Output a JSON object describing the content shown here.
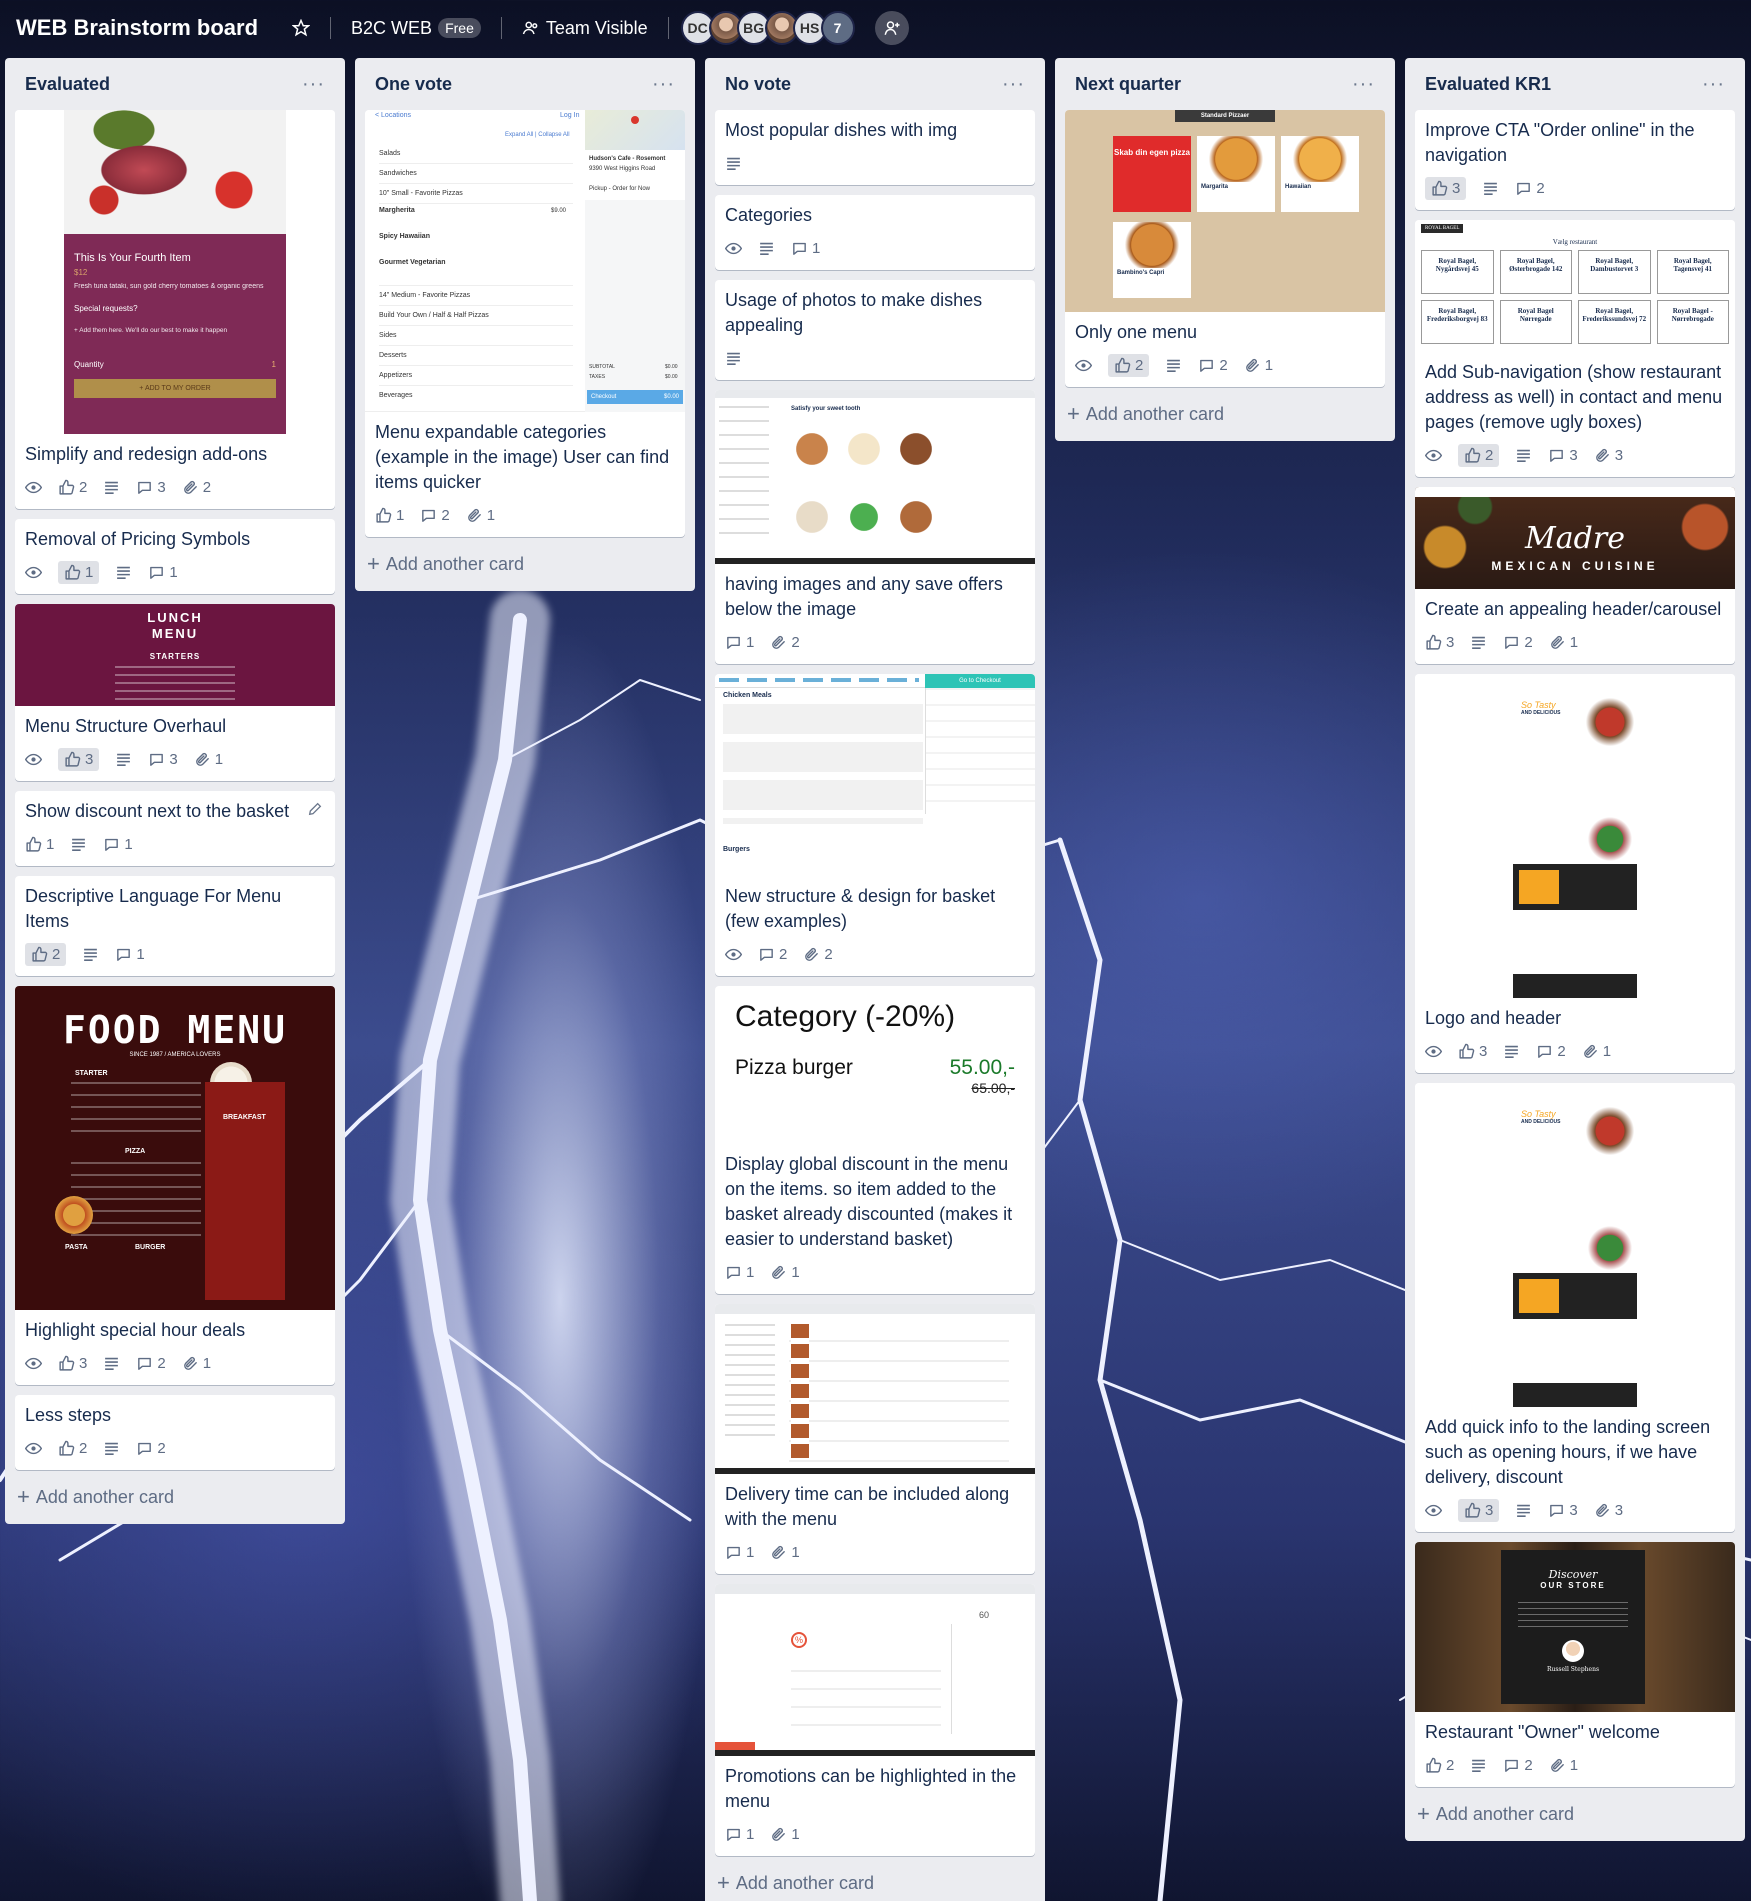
{
  "header": {
    "board_title": "WEB Brainstorm board",
    "team": "B2C WEB",
    "plan_badge": "Free",
    "visibility": "Team Visible",
    "members": [
      {
        "initials": "DC"
      },
      {
        "initials": ""
      },
      {
        "initials": "BG"
      },
      {
        "initials": ""
      },
      {
        "initials": "HS"
      }
    ],
    "extra_count": "7"
  },
  "add_card_label": "Add another card",
  "lists": [
    {
      "title": "Evaluated",
      "cards": [
        {
          "title": "Simplify and redesign add-ons",
          "votes": "2",
          "comments": "3",
          "attachments": "2",
          "cover": {
            "item": "This Is Your Fourth Item",
            "price": "$12",
            "desc": "Fresh tuna tataki, sun gold cherry tomatoes & organic greens",
            "special": "Special requests?",
            "add_hint": "+ Add them here. We'll do our best to make it happen",
            "quantity_label": "Quantity",
            "qty": "1",
            "cta": "+ ADD TO MY ORDER"
          }
        },
        {
          "title": "Removal of Pricing Symbols",
          "votes": "1",
          "comments": "1"
        },
        {
          "title": "Menu Structure Overhaul",
          "votes": "3",
          "comments": "3",
          "attachments": "1",
          "cover": {
            "l1": "LUNCH",
            "l2": "MENU",
            "l3": "STARTERS"
          }
        },
        {
          "title": "Show discount next to the basket",
          "votes": "1",
          "comments": "1"
        },
        {
          "title": "Descriptive Language For Menu Items",
          "votes": "2",
          "comments": "1"
        },
        {
          "title": "Highlight special hour deals",
          "votes": "3",
          "comments": "2",
          "attachments": "1",
          "cover": {
            "title": "FOOD MENU",
            "since": "SINCE 1987 / AMERICA LOVERS",
            "s1": "STARTER",
            "s2": "BREAKFAST",
            "s3": "PIZZA",
            "s4": "PASTA",
            "s5": "BURGER"
          }
        },
        {
          "title": "Less steps",
          "votes": "2",
          "comments": "2"
        }
      ]
    },
    {
      "title": "One vote",
      "cards": [
        {
          "title": "Menu expandable categories (example in the image) User can find items quicker",
          "votes": "1",
          "comments": "2",
          "attachments": "1",
          "cover": {
            "top_link": "< Locations",
            "login": "Log In",
            "expand": "Expand All  |  Collapse All",
            "rows": [
              "Salads",
              "Sandwiches",
              "10\" Small - Favorite Pizzas",
              "Margherita",
              "Spicy Hawaiian",
              "Gourmet Vegetarian",
              "14\" Medium - Favorite Pizzas",
              "Build Your Own / Half & Half Pizzas",
              "Sides",
              "Desserts",
              "Appetizers",
              "Beverages"
            ],
            "price": "$9.00",
            "restaurant": "Hudson's Cafe - Rosemont",
            "address": "9390 West Higgins Road",
            "pickup": "Pickup - Order for Now",
            "subtotal": "SUBTOTAL",
            "taxes": "TAXES",
            "checkout": "Checkout",
            "checkout_amt": "$0.00",
            "zero": "$0.00"
          }
        }
      ]
    },
    {
      "title": "No vote",
      "cards": [
        {
          "title": "Most popular dishes with img"
        },
        {
          "title": "Categories",
          "comments": "1"
        },
        {
          "title": "Usage of photos to make dishes appealing"
        },
        {
          "title": "having images and any save offers below the image",
          "comments": "1",
          "attachments": "2",
          "cover": {
            "heading": "Satisfy your sweet tooth"
          }
        },
        {
          "title": "New structure & design for basket (few examples)",
          "comments": "2",
          "attachments": "2",
          "cover": {
            "s1": "Chicken Meals",
            "s2": "Burgers",
            "cta": "Go to Checkout"
          }
        },
        {
          "title": "Display global discount in the menu on the items. so item added to the basket already discounted (makes it easier to understand basket)",
          "comments": "1",
          "attachments": "1",
          "category": {
            "title": "Category (-20%)",
            "item": "Pizza burger",
            "price": "55.00,-",
            "old_price": "65.00,-"
          }
        },
        {
          "title": "Delivery time can be included along with the menu",
          "comments": "1",
          "attachments": "1"
        },
        {
          "title": "Promotions can be highlighted in the menu",
          "comments": "1",
          "attachments": "1",
          "cover": {
            "pct": "%",
            "num": "60"
          }
        }
      ]
    },
    {
      "title": "Next quarter",
      "cards": [
        {
          "title": "Only one menu",
          "votes": "2",
          "comments": "2",
          "attachments": "1",
          "cover": {
            "banner": "Standard Pizzaer",
            "promo": "Skab din egen pizza",
            "p1": "Margarita",
            "p2": "Hawaiian",
            "p3": "Bambino's Capri"
          }
        }
      ]
    },
    {
      "title": "Evaluated KR1",
      "cards": [
        {
          "title": "Improve CTA \"Order online\" in the navigation",
          "votes": "3",
          "comments": "2"
        },
        {
          "title": "Add Sub-navigation (show restaurant address as well) in contact and menu pages (remove ugly boxes)",
          "votes": "2",
          "comments": "3",
          "attachments": "3",
          "cover": {
            "brand": "ROYAL BAGEL",
            "heading": "Vælg restaurant",
            "boxes": [
              "Royal Bagel, Nygårdsvej 45",
              "Royal Bagel, Østerbrogade 142",
              "Royal Bagel, Dambustorvet 3",
              "Royal Bagel, Tagensvej 41",
              "Royal Bagel, Frederiksborgvej 83",
              "Royal Bagel Nørregade",
              "Royal Bagel, Frederikssundsvej 72",
              "Royal Bagel - Nørrebrogade"
            ]
          }
        },
        {
          "title": "Create an appealing header/carousel",
          "votes": "3",
          "comments": "2",
          "attachments": "1",
          "cover": {
            "brand": "Madre",
            "sub": "MEXICAN CUISINE"
          }
        },
        {
          "title": "Logo and header",
          "votes": "3",
          "comments": "2",
          "attachments": "1",
          "cover": {
            "tag": "So Tasty",
            "sub": "AND DELICIOUS"
          }
        },
        {
          "title": "Add quick info to the landing screen such as opening hours, if we have delivery, discount",
          "votes": "3",
          "comments": "3",
          "attachments": "3",
          "cover": {
            "tag": "So Tasty",
            "sub": "AND DELICIOUS"
          }
        },
        {
          "title": "Restaurant \"Owner\" welcome",
          "votes": "2",
          "comments": "2",
          "attachments": "1",
          "cover": {
            "script": "Discover",
            "sub": "OUR STORE",
            "name": "Russell Stephens"
          }
        }
      ]
    }
  ],
  "colors": {
    "list_bg": "#ebecf0",
    "card_bg": "#ffffff",
    "text": "#172b4d",
    "meta": "#5e6c84"
  }
}
